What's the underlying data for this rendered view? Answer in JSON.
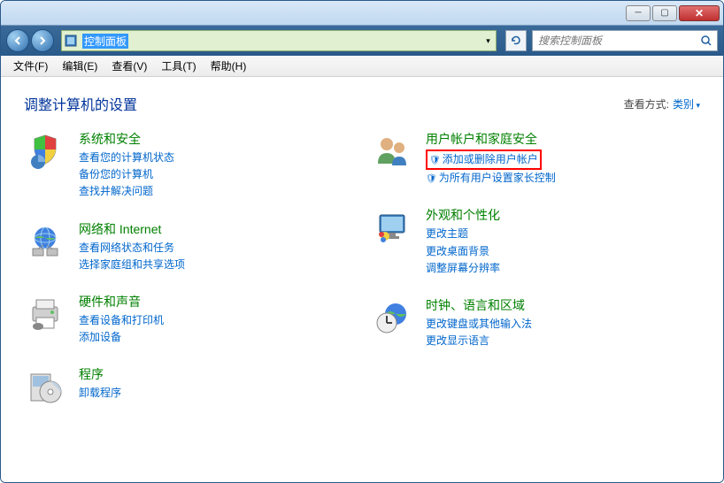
{
  "window": {
    "address_bar": "控制面板",
    "search_placeholder": "搜索控制面板"
  },
  "menu": {
    "file": "文件(F)",
    "edit": "编辑(E)",
    "view": "查看(V)",
    "tools": "工具(T)",
    "help": "帮助(H)"
  },
  "header": {
    "title": "调整计算机的设置",
    "view_by_label": "查看方式:",
    "view_by_value": "类别"
  },
  "categories": {
    "left": [
      {
        "title": "系统和安全",
        "links": [
          "查看您的计算机状态",
          "备份您的计算机",
          "查找并解决问题"
        ]
      },
      {
        "title": "网络和 Internet",
        "links": [
          "查看网络状态和任务",
          "选择家庭组和共享选项"
        ]
      },
      {
        "title": "硬件和声音",
        "links": [
          "查看设备和打印机",
          "添加设备"
        ]
      },
      {
        "title": "程序",
        "links": [
          "卸载程序"
        ]
      }
    ],
    "right": [
      {
        "title": "用户帐户和家庭安全",
        "links": [
          "添加或删除用户帐户",
          "为所有用户设置家长控制"
        ],
        "shields": [
          true,
          true
        ],
        "highlight_index": 0
      },
      {
        "title": "外观和个性化",
        "links": [
          "更改主题",
          "更改桌面背景",
          "调整屏幕分辨率"
        ]
      },
      {
        "title": "时钟、语言和区域",
        "links": [
          "更改键盘或其他输入法",
          "更改显示语言"
        ]
      }
    ]
  }
}
